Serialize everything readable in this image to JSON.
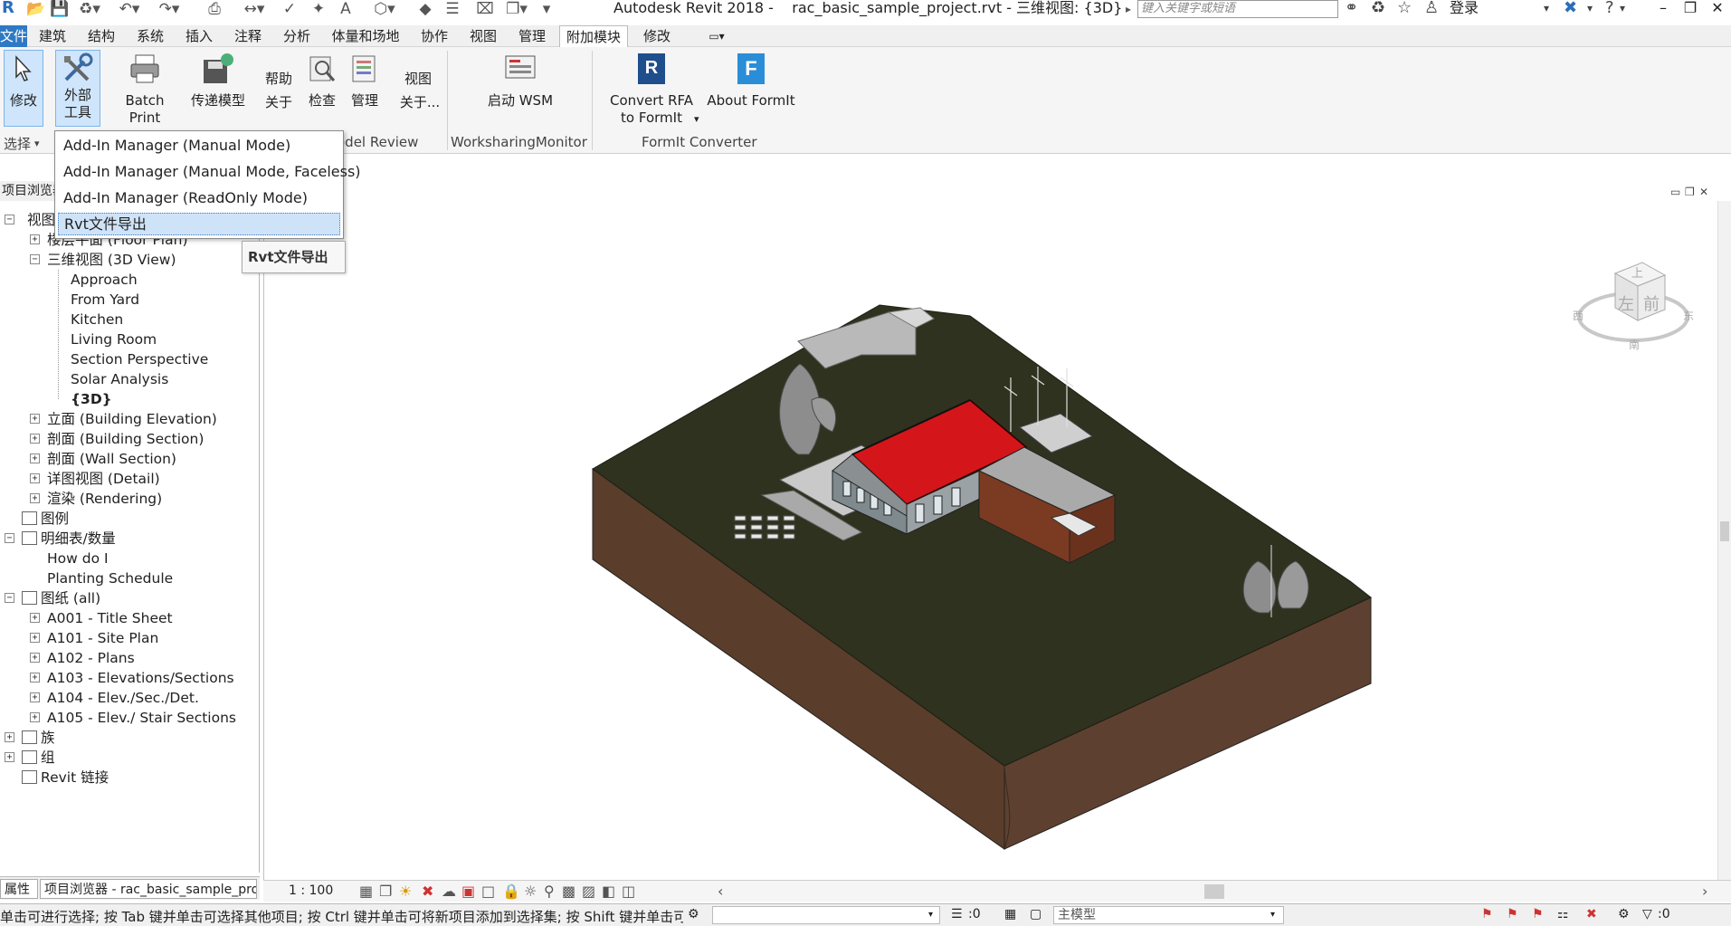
{
  "title": {
    "app_name": "Autodesk Revit 2018 -",
    "document": "rac_basic_sample_project.rvt - 三维视图: {3D}",
    "search_placeholder": "键入关键字或短语",
    "login": "登录"
  },
  "tabs": [
    "文件",
    "建筑",
    "结构",
    "系统",
    "插入",
    "注释",
    "分析",
    "体量和场地",
    "协作",
    "视图",
    "管理",
    "附加模块",
    "修改"
  ],
  "active_tab": "附加模块",
  "ribbon": {
    "modify_label": "修改",
    "external_tools_label_1": "外部",
    "external_tools_label_2": "工具",
    "batch_print": "Batch Print",
    "transmit_model": "传递模型",
    "help": "帮助",
    "about": "关于",
    "check": "检查",
    "manage": "管理",
    "view": "视图",
    "about_more": "关于...",
    "start_wsm": "启动 WSM",
    "convert_rfa_1": "Convert RFA",
    "convert_rfa_2": "to FormIt",
    "about_formit": "About FormIt",
    "select_label": "选择",
    "panel_model_review": "odel Review",
    "panel_wsm": "WorksharingMonitor",
    "panel_formit": "FormIt Converter"
  },
  "dropdown": {
    "items": [
      "Add-In Manager (Manual Mode)",
      "Add-In Manager (Manual Mode, Faceless)",
      "Add-In Manager (ReadOnly Mode)",
      "Rvt文件导出"
    ],
    "tooltip": "Rvt文件导出"
  },
  "browser": {
    "title": "项目浏览器",
    "nodes": [
      {
        "label": "视图 (all)",
        "level": 0,
        "expander": "-"
      },
      {
        "label": "楼层平面 (Floor Plan)",
        "level": 1,
        "expander": "+"
      },
      {
        "label": "三维视图 (3D View)",
        "level": 1,
        "expander": "-"
      },
      {
        "label": "Approach",
        "level": 2
      },
      {
        "label": "From Yard",
        "level": 2
      },
      {
        "label": "Kitchen",
        "level": 2
      },
      {
        "label": "Living Room",
        "level": 2
      },
      {
        "label": "Section Perspective",
        "level": 2
      },
      {
        "label": "Solar Analysis",
        "level": 2
      },
      {
        "label": "{3D}",
        "level": 2,
        "bold": true
      },
      {
        "label": "立面 (Building Elevation)",
        "level": 1,
        "expander": "+"
      },
      {
        "label": "剖面 (Building Section)",
        "level": 1,
        "expander": "+"
      },
      {
        "label": "剖面 (Wall Section)",
        "level": 1,
        "expander": "+"
      },
      {
        "label": "详图视图 (Detail)",
        "level": 1,
        "expander": "+"
      },
      {
        "label": "渲染 (Rendering)",
        "level": 1,
        "expander": "+"
      },
      {
        "label": "图例",
        "level": 0,
        "icon": true
      },
      {
        "label": "明细表/数量",
        "level": 0,
        "expander": "-",
        "icon": true
      },
      {
        "label": "How do I",
        "level": 1
      },
      {
        "label": "Planting Schedule",
        "level": 1
      },
      {
        "label": "图纸 (all)",
        "level": 0,
        "expander": "-",
        "icon": true
      },
      {
        "label": "A001 - Title Sheet",
        "level": 1,
        "expander": "+"
      },
      {
        "label": "A101 - Site Plan",
        "level": 1,
        "expander": "+"
      },
      {
        "label": "A102 - Plans",
        "level": 1,
        "expander": "+"
      },
      {
        "label": "A103 - Elevations/Sections",
        "level": 1,
        "expander": "+"
      },
      {
        "label": "A104 - Elev./Sec./Det.",
        "level": 1,
        "expander": "+"
      },
      {
        "label": "A105 - Elev./ Stair Sections",
        "level": 1,
        "expander": "+"
      },
      {
        "label": "族",
        "level": 0,
        "expander": "+",
        "icon": true
      },
      {
        "label": "组",
        "level": 0,
        "expander": "+",
        "icon": true
      },
      {
        "label": "Revit 链接",
        "level": 0,
        "icon": true
      }
    ],
    "tab_properties": "属性",
    "tab_browser": "项目浏览器 - rac_basic_sample_proje..."
  },
  "viewcube": {
    "top": "上",
    "left": "左",
    "front": "前",
    "west": "西",
    "east": "东",
    "south": "南"
  },
  "view_control": {
    "scale": "1 : 100"
  },
  "status": {
    "message": "单击可进行选择; 按 Tab 键并单击可选择其他项目; 按 Ctrl 键并单击可将新项目添加到选择集; 按 Shift 键并单击可",
    "zero_a": ":0",
    "main_model": "主模型",
    "zero_b": ":0"
  },
  "colors": {
    "roof": "#d4161b",
    "terrain_top": "#2f321f",
    "terrain_side": "#5a3d2b",
    "file_tab": "#2f79c4"
  }
}
